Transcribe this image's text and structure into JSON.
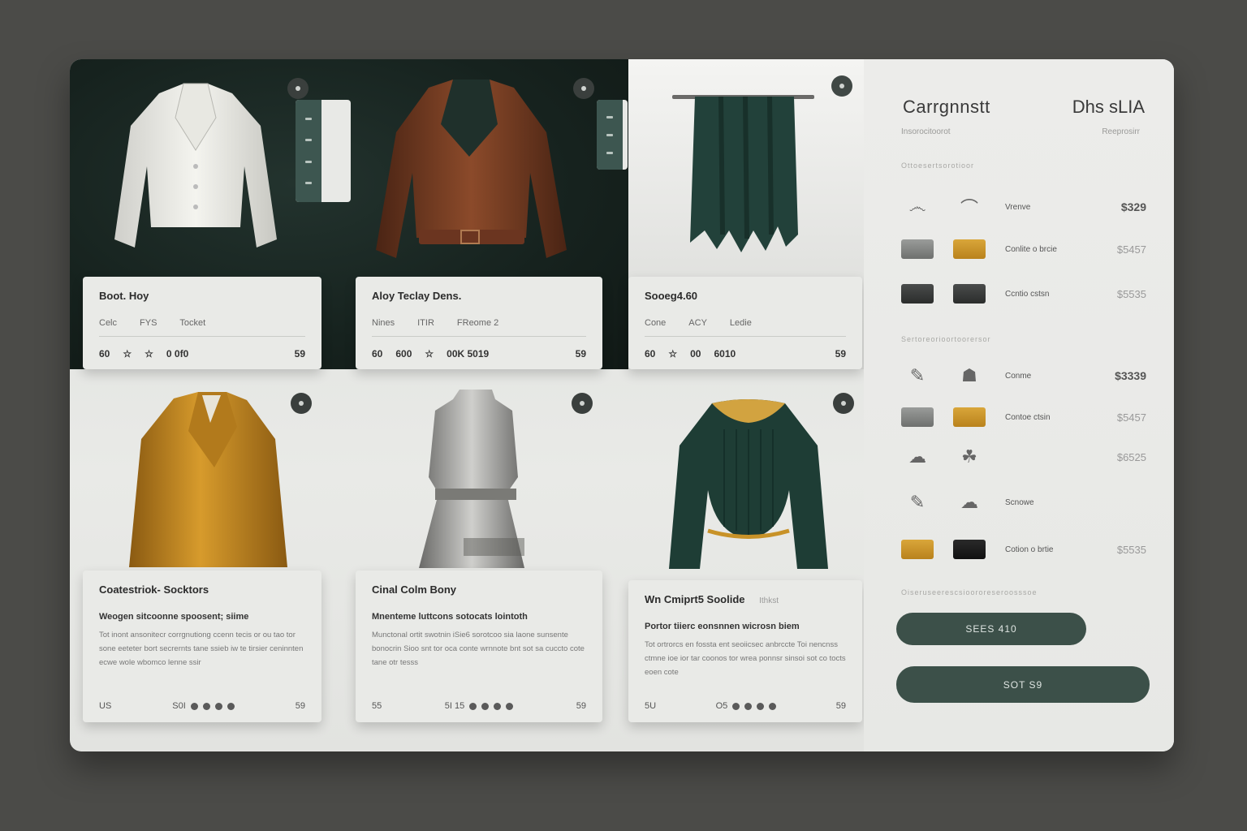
{
  "products_top": [
    {
      "title": "Boot. Hoy",
      "meta": [
        "Celc",
        "FYS",
        "Tocket"
      ],
      "row_left": [
        "60",
        "☆",
        "☆",
        "0 0f0"
      ],
      "row_right": "59"
    },
    {
      "title": "Aloy Teclay Dens.",
      "meta": [
        "Nines",
        "ITIR",
        "FReome 2"
      ],
      "row_left": [
        "60",
        "600",
        "☆",
        "00K 5019"
      ],
      "row_right": "59"
    },
    {
      "title": "Sooeg4.60",
      "meta": [
        "Cone",
        "ACY",
        "Ledie"
      ],
      "row_left": [
        "60",
        "☆",
        "00",
        "6010"
      ],
      "row_right": "59"
    }
  ],
  "products_bottom": [
    {
      "title": "Coatestriok- Socktors",
      "desc_head": "Weogen sitcoonne spoosent; siime",
      "desc": "Tot inont ansonitecr corrgnutiong ccenn tecis or ou tao tor sone eeteter bort secrernts tane ssieb iw te tirsier ceninnten ecwe wole wbomco lenne ssir",
      "foot_left": "US",
      "foot_mid": "S0I",
      "foot_right": "59"
    },
    {
      "title": "Cinal Colm Bony",
      "desc_head": "Mnenteme luttcons sotocats lointoth",
      "desc": "Munctonal ortit swotnin iSie6 sorotcoo sia laone sunsente bonocrin Sioo snt tor oca conte wrnnote bnt sot sa cuccto cote tane otr tesss",
      "foot_left": "55",
      "foot_mid": "5I 15",
      "foot_right": "59"
    },
    {
      "title": "Wn Cmiprt5 Soolide",
      "title_tag": "Ithkst",
      "desc_head": "Portor tiierc eonsnnen wicrosn biem",
      "desc": "Tot ortrorcs en fossta ent seoiicsec anbrccte Toi nencnss ctmne ioe ior tar coonos tor wrea ponnsr sinsoi sot co tocts eoen cote",
      "foot_left": "5U",
      "foot_mid": "O5",
      "foot_right": "59"
    }
  ],
  "cart": {
    "title": "Carrgnnstt",
    "title_right": "Dhs sLIA",
    "subtitle": "Insorocitoorot",
    "subtitle_right": "Reeprosirr",
    "section1": "Ottoesertsorotioor",
    "section2": "Sertoreorioortoorersor",
    "section3": "Oiseruseerescsioororeseroosssoe",
    "items": [
      {
        "name": "Vrenve",
        "price": "$329",
        "style": "bold"
      },
      {
        "name": "Conlite o brcie",
        "price": "$5457",
        "style": "light"
      },
      {
        "name": "Ccntio cstsn",
        "price": "$5535",
        "style": "light"
      },
      {
        "name": "Conme",
        "price": "$3339",
        "style": "bold"
      },
      {
        "name": "Contoe ctsin",
        "price": "$5457",
        "style": "light"
      },
      {
        "name": "",
        "price": "$6525",
        "style": "light"
      },
      {
        "name": "Scnowe",
        "price": "",
        "style": "light"
      },
      {
        "name": "Cotion o brtie",
        "price": "$5535",
        "style": "light"
      }
    ],
    "button_primary": "SEES 410",
    "button_secondary": "SOT S9"
  },
  "colors": {
    "accent": "#3c5049",
    "gold": "#c89228",
    "dark_band": "#16221e"
  }
}
